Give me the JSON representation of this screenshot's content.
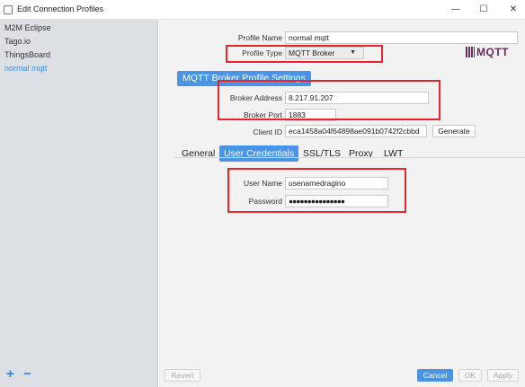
{
  "window": {
    "title": "Edit Connection Profiles",
    "minimize_glyph": "—",
    "maximize_glyph": "☐",
    "close_glyph": "✕"
  },
  "sidebar": {
    "items": [
      {
        "label": "M2M Eclipse",
        "selected": false
      },
      {
        "label": "Tago.io",
        "selected": false
      },
      {
        "label": "ThingsBoard",
        "selected": false
      },
      {
        "label": "normal mqtt",
        "selected": true
      }
    ],
    "add_label": "+",
    "remove_label": "−"
  },
  "profile": {
    "name_label": "Profile Name",
    "name_value": "normal mqtt",
    "type_label": "Profile Type",
    "type_value": "MQTT Broker",
    "type_arrow": "▼",
    "logo_text": "MQTT"
  },
  "broker": {
    "section_title": "MQTT Broker Profile Settings",
    "address_label": "Broker Address",
    "address_value": "8.217.91.207",
    "port_label": "Broker Port",
    "port_value": "1883",
    "client_id_label": "Client ID",
    "client_id_value": "eca1458a04f64898ae091b0742f2cbbd",
    "generate_label": "Generate"
  },
  "tabs": [
    {
      "label": "General",
      "active": false
    },
    {
      "label": "User Credentials",
      "active": true
    },
    {
      "label": "SSL/TLS",
      "active": false
    },
    {
      "label": "Proxy",
      "active": false
    },
    {
      "label": "LWT",
      "active": false
    }
  ],
  "credentials": {
    "username_label": "User Name",
    "username_value": "usenamedragino",
    "password_label": "Password",
    "password_value": "●●●●●●●●●●●●●●●"
  },
  "footer": {
    "revert_label": "Revert",
    "cancel_label": "Cancel",
    "ok_label": "OK",
    "apply_label": "Apply"
  },
  "colors": {
    "accent": "#4a94e6",
    "highlight": "#e8242c",
    "selected_text": "#3c8ee8",
    "logo": "#6b2a5e"
  }
}
